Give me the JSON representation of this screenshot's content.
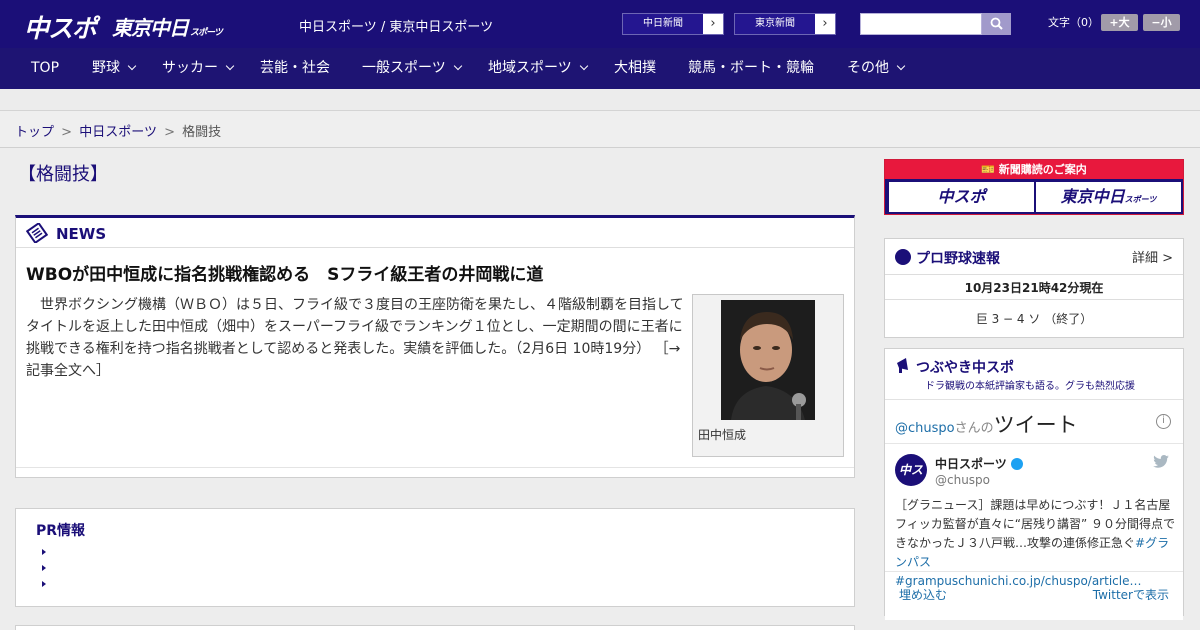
{
  "header": {
    "logo_chuspo": "中スポ",
    "logo_tokyo": "東京中日",
    "logo_tokyo_small": "スポーツ",
    "site_title": "中日スポーツ / 東京中日スポーツ",
    "link_chunichi": "中日新聞",
    "link_tokyo": "東京新聞",
    "search": {
      "value": "",
      "placeholder": ""
    },
    "font_size_label": "文字（0）",
    "font_larger": "+大",
    "font_smaller": "−小"
  },
  "nav": {
    "items": [
      {
        "label": "TOP",
        "has_dropdown": false
      },
      {
        "label": "野球",
        "has_dropdown": true
      },
      {
        "label": "サッカー",
        "has_dropdown": true
      },
      {
        "label": "芸能・社会",
        "has_dropdown": false
      },
      {
        "label": "一般スポーツ",
        "has_dropdown": true
      },
      {
        "label": "地域スポーツ",
        "has_dropdown": true
      },
      {
        "label": "大相撲",
        "has_dropdown": false
      },
      {
        "label": "競馬・ボート・競輪",
        "has_dropdown": false
      },
      {
        "label": "その他",
        "has_dropdown": true
      }
    ]
  },
  "breadcrumb": {
    "items": [
      "トップ",
      "中日スポーツ",
      "格闘技"
    ],
    "separator": ">"
  },
  "main": {
    "category_title": "【格闘技】",
    "news_label": "NEWS",
    "article": {
      "headline": "WBOが田中恒成に指名挑戦権認める　Sフライ級王者の井岡戦に道",
      "body": "　世界ボクシング機構（ＷＢＯ）は５日、フライ級で３度目の王座防衛を果たし、４階級制覇を目指してタイトルを返上した田中恒成（畑中）をスーパーフライ級でランキング１位とし、一定期間の間に王者に挑戦できる権利を持つ指名挑戦者として認めると発表した。実績を評価した。（2月6日 10時19分）",
      "read_more": "［→記事全文へ］",
      "photo_caption": "田中恒成"
    },
    "pr_title": "PR情報"
  },
  "sidebar": {
    "subscription_banner": "新聞購読のご案内",
    "sub_logo_1": "中スポ",
    "sub_logo_2": "東京中日",
    "sub_logo_2_small": "スポーツ",
    "baseball": {
      "title": "プロ野球速報",
      "more": "詳細 >",
      "time": "10月23日21時42分現在",
      "score": "巨 3 − 4 ソ （終了）"
    },
    "tsubuyaki": {
      "title": "つぶやき中スポ",
      "subtitle": "ドラ観戦の本紙評論家も語る。グラも熱烈応援",
      "tweet_header_handle": "@chuspo",
      "tweet_header_san": "さんの",
      "tweet_header_big": "ツイート",
      "avatar_text": "中スポ",
      "name": "中日スポーツ",
      "handle": "@chuspo",
      "tweet_text": "［グラニュース］課題は早めにつぶす！Ｊ１名古屋フィッカ監督が直々に“居残り講習” ９０分間得点できなかったＪ３八戸戦…攻撃の連係修正急ぐ",
      "tweet_link": "#グランパス #grampuschunichi.co.jp/chuspo/article…",
      "embed": "埋め込む",
      "view_on_twitter": "Twitterで表示"
    }
  },
  "colors": {
    "header_bg": "#1b0f78",
    "nav_bg": "#1e1473",
    "accent_red": "#e8183d",
    "link_blue": "#1d6ea8"
  }
}
